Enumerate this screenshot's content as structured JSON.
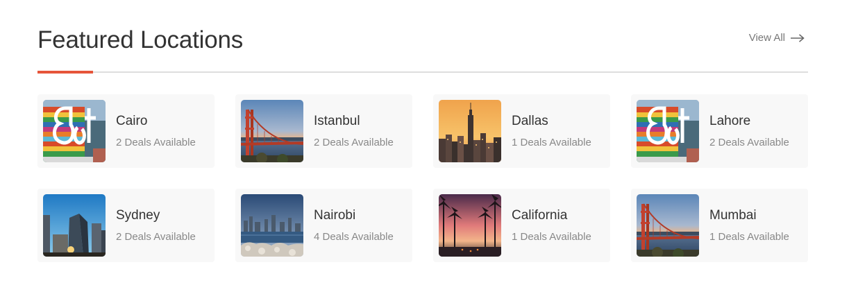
{
  "header": {
    "title": "Featured Locations",
    "view_all_label": "View All",
    "accent_color": "#e6553a"
  },
  "locations": [
    {
      "name": "Cairo",
      "deals": "2 Deals Available",
      "image": "colorful-letters-sculpture"
    },
    {
      "name": "Istanbul",
      "deals": "2 Deals Available",
      "image": "golden-gate-bridge"
    },
    {
      "name": "Dallas",
      "deals": "1 Deals Available",
      "image": "city-skyline-sunset"
    },
    {
      "name": "Lahore",
      "deals": "2 Deals Available",
      "image": "colorful-letters-sculpture"
    },
    {
      "name": "Sydney",
      "deals": "2 Deals Available",
      "image": "glass-towers-blue-sky"
    },
    {
      "name": "Nairobi",
      "deals": "4 Deals Available",
      "image": "harbor-skyline"
    },
    {
      "name": "California",
      "deals": "1 Deals Available",
      "image": "palm-trees-sunset"
    },
    {
      "name": "Mumbai",
      "deals": "1 Deals Available",
      "image": "golden-gate-bridge"
    }
  ]
}
